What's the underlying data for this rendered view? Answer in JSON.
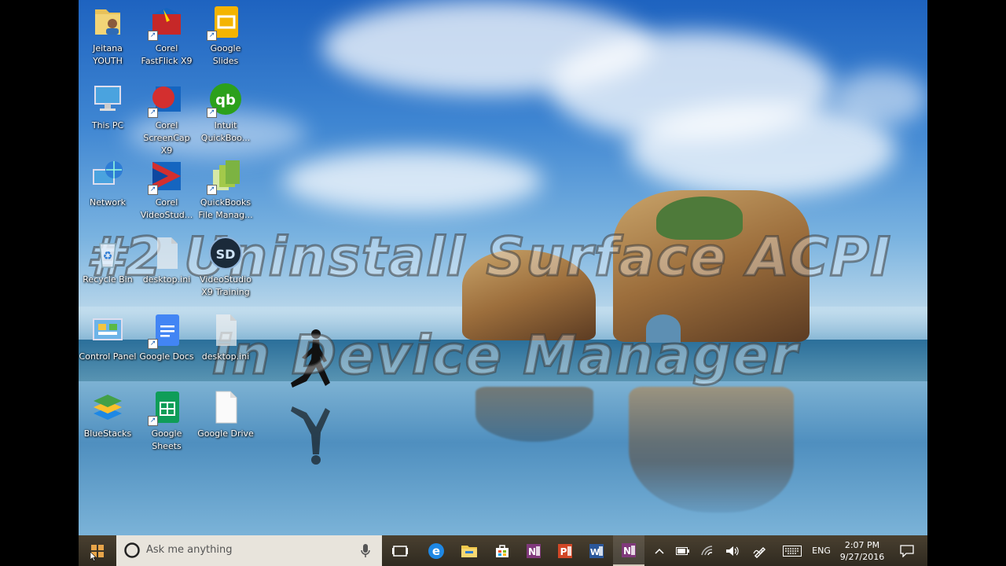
{
  "overlay": {
    "line1": "#2 Uninstall Surface ACPI",
    "line2": "in Device Manager"
  },
  "desktop_icons": [
    {
      "label": "Jeitana YOUTH",
      "icon": "user-folder-icon"
    },
    {
      "label": "Corel FastFlick X9",
      "icon": "corel-fastflick-icon"
    },
    {
      "label": "Google Slides",
      "icon": "google-slides-icon"
    },
    {
      "label": "This PC",
      "icon": "computer-icon"
    },
    {
      "label": "Corel ScreenCap X9",
      "icon": "corel-screencap-icon"
    },
    {
      "label": "Intuit QuickBoo...",
      "icon": "quickbooks-icon"
    },
    {
      "label": "Network",
      "icon": "network-icon"
    },
    {
      "label": "Corel VideoStud...",
      "icon": "corel-videostudio-icon"
    },
    {
      "label": "QuickBooks File Manag...",
      "icon": "quickbooks-file-manager-icon"
    },
    {
      "label": "Recycle Bin",
      "icon": "recycle-bin-icon"
    },
    {
      "label": "desktop.ini",
      "icon": "ini-file-icon"
    },
    {
      "label": "VideoStudio X9 Training",
      "icon": "videostudio-training-icon"
    },
    {
      "label": "Control Panel",
      "icon": "control-panel-icon"
    },
    {
      "label": "Google Docs",
      "icon": "google-docs-icon"
    },
    {
      "label": "desktop.ini",
      "icon": "ini-file-icon"
    },
    {
      "label": "BlueStacks",
      "icon": "bluestacks-icon"
    },
    {
      "label": "Google Sheets",
      "icon": "google-sheets-icon"
    },
    {
      "label": "Google Drive",
      "icon": "google-drive-icon"
    }
  ],
  "taskbar": {
    "search_placeholder": "Ask me anything",
    "pinned": [
      "task-view-icon",
      "edge-icon",
      "file-explorer-icon",
      "store-icon",
      "onenote-icon",
      "powerpoint-icon",
      "word-icon",
      "onenote-icon"
    ],
    "tray": {
      "language": "ENG",
      "time": "2:07 PM",
      "date": "9/27/2016"
    }
  },
  "colors": {
    "taskbar_bg": "#3a3326",
    "search_bg": "#e8e4dc",
    "overlay_text": "#ffffff"
  }
}
